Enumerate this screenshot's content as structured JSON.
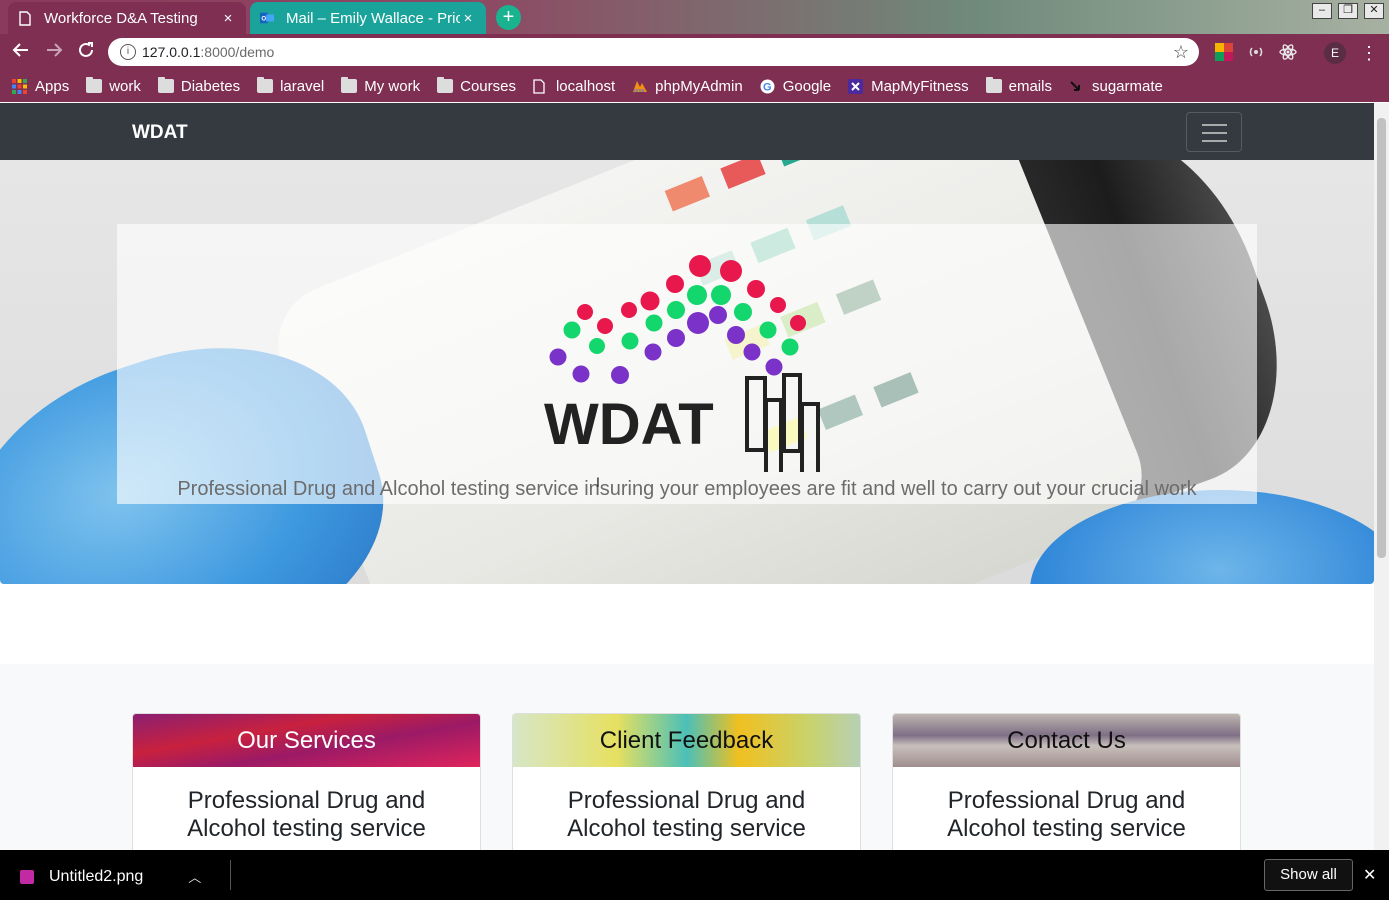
{
  "browser": {
    "tabs": [
      {
        "title": "Workforce D&A Testing",
        "close": "×"
      },
      {
        "title": "Mail – Emily Wallace - Pric",
        "close": "×"
      }
    ],
    "new_tab": "+",
    "window_controls": {
      "minimize": "–",
      "restore": "❐",
      "close": "✕"
    },
    "address": {
      "host": "127.0.0.1",
      "path": ":8000/demo"
    },
    "profile_initial": "E",
    "bookmarks": [
      {
        "label": "Apps",
        "icon": "apps-grid-icon"
      },
      {
        "label": "work",
        "icon": "folder-icon"
      },
      {
        "label": "Diabetes",
        "icon": "folder-icon"
      },
      {
        "label": "laravel",
        "icon": "folder-icon"
      },
      {
        "label": "My work",
        "icon": "folder-icon"
      },
      {
        "label": "Courses",
        "icon": "folder-icon"
      },
      {
        "label": "localhost",
        "icon": "page-icon"
      },
      {
        "label": "phpMyAdmin",
        "icon": "phpmyadmin-icon"
      },
      {
        "label": "Google",
        "icon": "google-icon"
      },
      {
        "label": "MapMyFitness",
        "icon": "underarmour-icon"
      },
      {
        "label": "emails",
        "icon": "folder-icon"
      },
      {
        "label": "sugarmate",
        "icon": "sugarmate-icon"
      }
    ]
  },
  "site": {
    "brand": "WDAT",
    "hero": {
      "logo_text": "WDAT",
      "tagline": "Professional Drug and Alcohol testing service insuring your employees are fit and well to carry out your crucial work"
    },
    "cards": [
      {
        "title": "Our Services",
        "body": "Professional Drug and Alcohol testing service"
      },
      {
        "title": "Client Feedback",
        "body": "Professional Drug and Alcohol testing service"
      },
      {
        "title": "Contact Us",
        "body": "Professional Drug and Alcohol testing service"
      }
    ]
  },
  "downloads": {
    "file": "Untitled2.png",
    "show_all": "Show all",
    "close": "✕"
  },
  "colors": {
    "chrome": "#7e2f52",
    "active_tab": "#19a39a",
    "navbar": "#343a40",
    "logo_red": "#e8174c",
    "logo_green": "#13d66c",
    "logo_purple": "#7a32c8"
  }
}
